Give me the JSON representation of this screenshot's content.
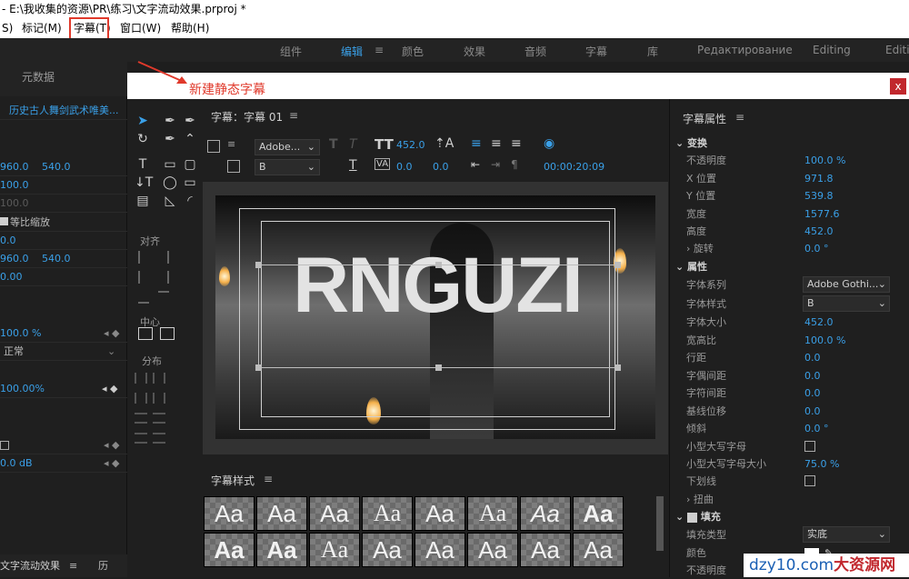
{
  "window": {
    "title": "- E:\\我收集的资源\\PR\\练习\\文字流动效果.prproj *"
  },
  "menu": {
    "items": [
      "S)",
      "标记(M)",
      "字幕(T)",
      "窗口(W)",
      "帮助(H)"
    ]
  },
  "workspace": {
    "tabs": [
      "组件",
      "编辑",
      "颜色",
      "效果",
      "音频",
      "字幕",
      "库",
      "Редактирование",
      "Editing",
      "Editin"
    ],
    "active": "编辑"
  },
  "left_panel": {
    "metadata_tab": "元数据",
    "clip_name": "历史古人舞剑武术唯美...",
    "position": [
      "960.0",
      "540.0"
    ],
    "scale": "100.0",
    "scale_width": "100.0",
    "uniform_scale": "等比缩放",
    "rotation": "0.0",
    "anchor": [
      "960.0",
      "540.0"
    ],
    "anti_flicker": "0.00",
    "opacity": "100.0 %",
    "blend_mode": "正常",
    "speed": "100.00%",
    "volume": "0.0 dB",
    "sequence_tab": "文字流动效果",
    "history_tab": "历"
  },
  "callout": {
    "text": "新建静态字幕",
    "color": "#e0392b"
  },
  "dialog": {
    "close_label": "x",
    "title_header": "字幕：字幕 01",
    "font_family": "Adobe...",
    "font_style": "B",
    "font_size": "452.0",
    "kerning": "0.0",
    "leading": "0.0",
    "tracking": "0.0",
    "timecode": "00:00:20:09",
    "align_label": "对齐",
    "center_label": "中心",
    "distribute_label": "分布",
    "canvas_text": "RNGUZI",
    "styles_header": "字幕样式",
    "styles": [
      "Aa",
      "Aa",
      "Aa",
      "Aa",
      "Aa",
      "Aa",
      "Aa",
      "Aa",
      "Aa",
      "Aa",
      "Aa",
      "Aa",
      "Aa",
      "Aa",
      "Aa",
      "Aa"
    ]
  },
  "properties": {
    "header": "字幕属性",
    "transform": "变换",
    "opacity_label": "不透明度",
    "opacity": "100.0 %",
    "x_label": "X 位置",
    "x": "971.8",
    "y_label": "Y 位置",
    "y": "539.8",
    "width_label": "宽度",
    "width": "1577.6",
    "height_label": "高度",
    "height": "452.0",
    "rotation_label": "旋转",
    "rotation": "0.0 °",
    "properties_section": "属性",
    "font_family_label": "字体系列",
    "font_family": "Adobe Gothi...",
    "font_style_label": "字体样式",
    "font_style": "B",
    "font_size_label": "字体大小",
    "font_size": "452.0",
    "aspect_label": "宽高比",
    "aspect": "100.0 %",
    "leading_label": "行距",
    "leading": "0.0",
    "kerning_label": "字偶间距",
    "kerning": "0.0",
    "tracking_label": "字符间距",
    "tracking": "0.0",
    "baseline_label": "基线位移",
    "baseline": "0.0",
    "slant_label": "倾斜",
    "slant": "0.0 °",
    "smallcaps_label": "小型大写字母",
    "smallcaps_size_label": "小型大写字母大小",
    "smallcaps_size": "75.0 %",
    "underline_label": "下划线",
    "distort_label": "扭曲",
    "fill_section": "填充",
    "fill_type_label": "填充类型",
    "fill_type": "实底",
    "color_label": "颜色",
    "fill_opacity_label": "不透明度"
  },
  "watermark": {
    "text": "dzy10.com",
    "suffix": "大资源网"
  }
}
